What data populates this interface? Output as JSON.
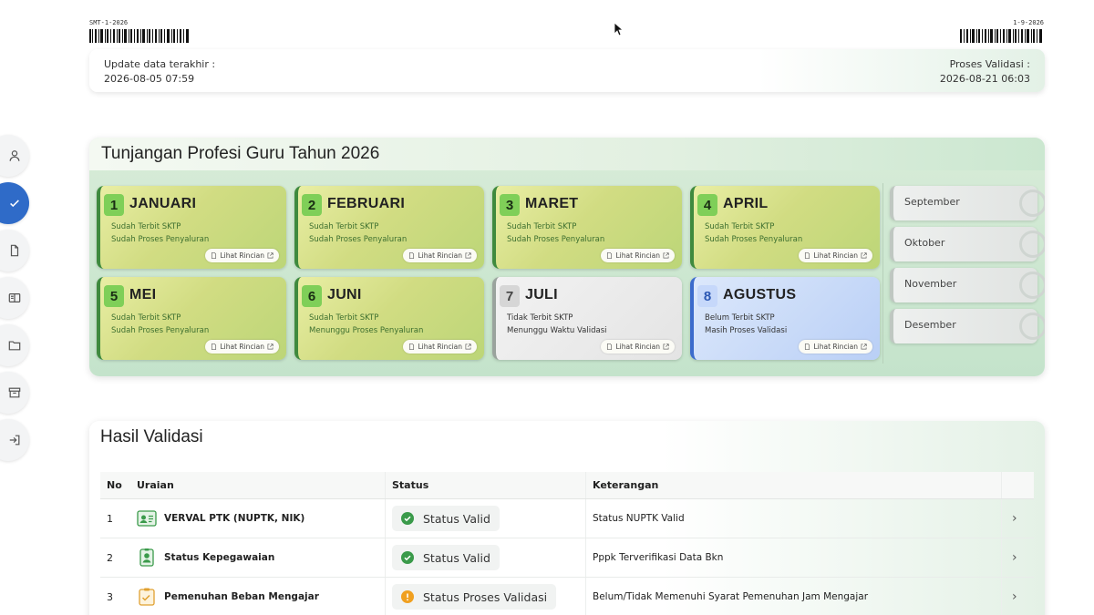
{
  "top": {
    "left_code": "SMT-1-2026",
    "right_code": "1-9-2026"
  },
  "update": {
    "left_label": "Update data terakhir :",
    "left_value": "2026-08-05 07:59",
    "right_label": "Proses Validasi :",
    "right_value": "2026-08-21 06:03"
  },
  "sidebar": {
    "items": [
      {
        "name": "user-icon"
      },
      {
        "name": "check-icon",
        "active": true
      },
      {
        "name": "document-icon"
      },
      {
        "name": "book-icon"
      },
      {
        "name": "folder-icon"
      },
      {
        "name": "archive-icon"
      },
      {
        "name": "logout-icon"
      }
    ]
  },
  "tpg": {
    "title": "Tunjangan Profesi Guru Tahun 2026",
    "button_label": "Lihat Rincian",
    "months": [
      {
        "num": "1",
        "name": "JANUARI",
        "line1": "Sudah Terbit SKTP",
        "line2": "Sudah Proses Penyaluran",
        "style": "green"
      },
      {
        "num": "2",
        "name": "FEBRUARI",
        "line1": "Sudah Terbit SKTP",
        "line2": "Sudah Proses Penyaluran",
        "style": "green"
      },
      {
        "num": "3",
        "name": "MARET",
        "line1": "Sudah Terbit SKTP",
        "line2": "Sudah Proses Penyaluran",
        "style": "green"
      },
      {
        "num": "4",
        "name": "APRIL",
        "line1": "Sudah Terbit SKTP",
        "line2": "Sudah Proses Penyaluran",
        "style": "green"
      },
      {
        "num": "5",
        "name": "MEI",
        "line1": "Sudah Terbit SKTP",
        "line2": "Sudah Proses Penyaluran",
        "style": "green"
      },
      {
        "num": "6",
        "name": "JUNI",
        "line1": "Sudah Terbit SKTP",
        "line2": "Menunggu Proses Penyaluran",
        "style": "green"
      },
      {
        "num": "7",
        "name": "JULI",
        "line1": "Tidak Terbit SKTP",
        "line2": "Menunggu Waktu Validasi",
        "style": "grey"
      },
      {
        "num": "8",
        "name": "AGUSTUS",
        "line1": "Belum Terbit SKTP",
        "line2": "Masih Proses Validasi",
        "style": "blue"
      }
    ],
    "later_months": [
      "September",
      "Oktober",
      "November",
      "Desember"
    ]
  },
  "validasi": {
    "title": "Hasil Validasi",
    "headers": {
      "no": "No",
      "uraian": "Uraian",
      "status": "Status",
      "keterangan": "Keterangan"
    },
    "rows": [
      {
        "no": "1",
        "uraian": "VERVAL PTK (NUPTK, NIK)",
        "icon": "id-card-icon",
        "status": "Status Valid",
        "status_color": "#3a9a4a",
        "keterangan": "Status NUPTK Valid"
      },
      {
        "no": "2",
        "uraian": "Status Kepegawaian",
        "icon": "badge-icon",
        "status": "Status Valid",
        "status_color": "#3a9a4a",
        "keterangan": "Pppk Terverifikasi Data Bkn"
      },
      {
        "no": "3",
        "uraian": "Pemenuhan Beban Mengajar",
        "icon": "checklist-icon",
        "status": "Status Proses Validasi",
        "status_color": "#f0a020",
        "keterangan": "Belum/Tidak Memenuhi Syarat Pemenuhan Jam Mengajar"
      }
    ]
  }
}
